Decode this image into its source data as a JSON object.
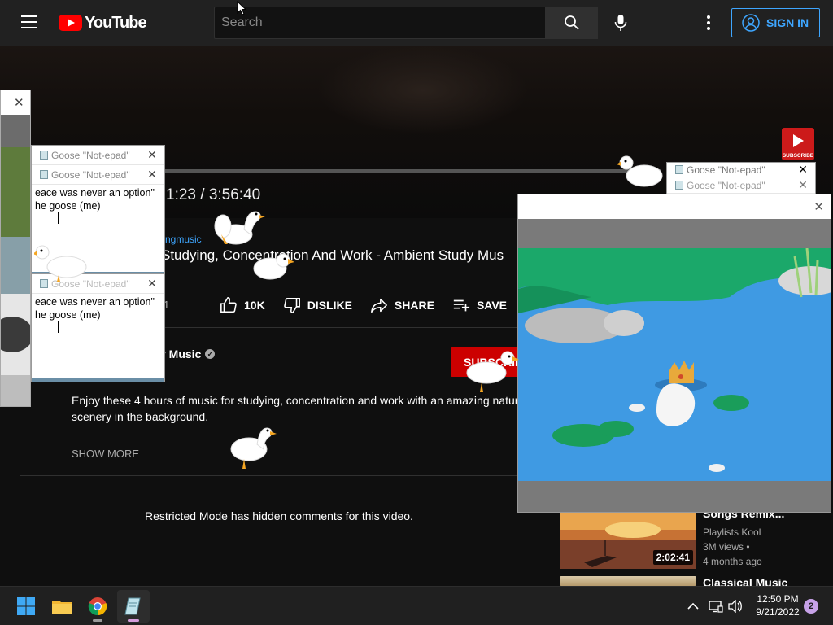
{
  "header": {
    "logo_text": "YouTube",
    "search_placeholder": "Search",
    "sign_in_label": "SIGN IN"
  },
  "player": {
    "time_text": "1:23 / 3:56:40",
    "watermark_label": "SUBSCRIBE"
  },
  "video": {
    "channel_tag": "ngmusic",
    "title": "Studying, Concentration And Work - Ambient Study Mus",
    "views_fragment": "1",
    "actions": {
      "like_count": "10K",
      "dislike_label": "DISLIKE",
      "share_label": "SHARE",
      "save_label": "SAVE"
    },
    "channel_name_fragment": "y Music",
    "subscribe_label": "SUBSCRIBE",
    "description_line1": "Enjoy these 4 hours of music for studying, concentration and work with an amazing natur",
    "description_line2": "scenery in the background.",
    "show_more_label": "SHOW MORE",
    "restricted_text": "Restricted Mode has hidden comments for this video."
  },
  "recommendations": [
    {
      "title": "Songs Remix...",
      "channel": "Playlists Kool",
      "views": "3M views •",
      "age": "4 months ago",
      "duration": "2:02:41"
    },
    {
      "title": "Classical Music"
    }
  ],
  "goose_windows": {
    "title": "Goose \"Not-epad\"",
    "quote_line1": "eace was never an option\"",
    "quote_line2": "he goose (me)"
  },
  "taskbar": {
    "time": "12:50 PM",
    "date": "9/21/2022",
    "notification_count": "2"
  },
  "colors": {
    "youtube_red": "#ff0000",
    "subscribe_red": "#cc0000",
    "link_blue": "#3ea6ff",
    "background": "#0f0f0f",
    "taskbar": "#202020"
  }
}
